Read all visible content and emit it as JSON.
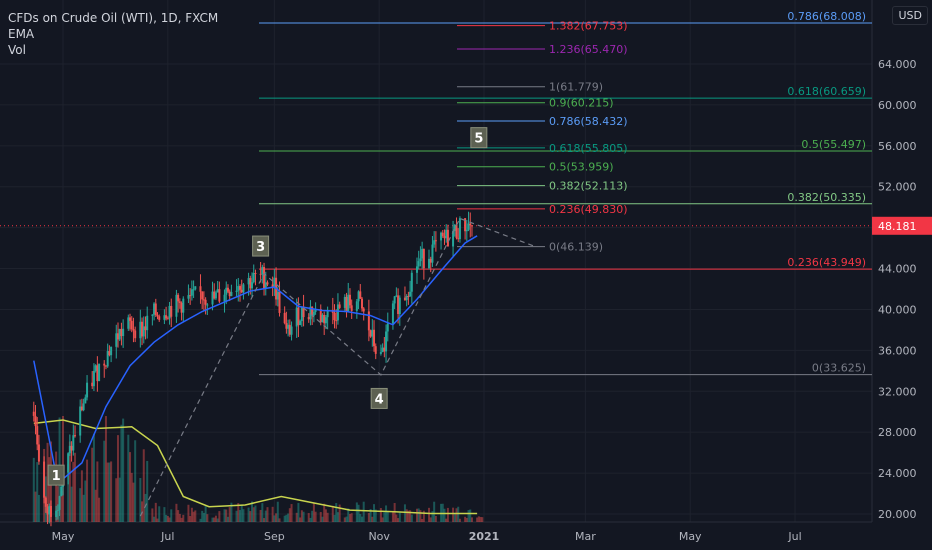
{
  "legend": {
    "title": "CFDs on Crude Oil (WTI), 1D, FXCM",
    "ema_label": "EMA",
    "vol_label": "Vol"
  },
  "currency_button": "USD",
  "chart_data": {
    "type": "line",
    "title": "CFDs on Crude Oil (WTI), 1D, FXCM",
    "x_ticks": [
      "May",
      "Jul",
      "Sep",
      "Nov",
      "2021",
      "Mar",
      "May",
      "Jul"
    ],
    "y_ticks": [
      "20.000",
      "24.000",
      "28.000",
      "32.000",
      "36.000",
      "40.000",
      "44.000",
      "48.000",
      "52.000",
      "56.000",
      "60.000",
      "64.000"
    ],
    "ylim": [
      19.5,
      70
    ],
    "price_label": "48.181",
    "colors": {
      "background": "#131722",
      "ema": "#2962ff",
      "volume_ma": "#c8d44e",
      "up": "#26a69a",
      "down": "#ef5350",
      "price_tag": "#f23645"
    },
    "wave_labels": [
      {
        "label": "1",
        "x": "2020-04-27",
        "y": 23.8
      },
      {
        "label": "3",
        "x": "2020-08-24",
        "y": 46.2
      },
      {
        "label": "4",
        "x": "2020-11-01",
        "y": 31.3
      },
      {
        "label": "5",
        "x": "2020-12-29",
        "y": 56.8
      }
    ],
    "elliott_path": [
      {
        "x": "2020-06-15",
        "y": 19.8
      },
      {
        "x": "2020-08-26",
        "y": 43.5
      },
      {
        "x": "2020-11-02",
        "y": 33.6
      },
      {
        "x": "2020-12-18",
        "y": 48.9
      },
      {
        "x": "2021-01-30",
        "y": 46.2
      }
    ],
    "fib_left": [
      {
        "label": "0.786(68.008)",
        "value": 68.008,
        "color": "#5b9cf6"
      },
      {
        "label": "0.618(60.659)",
        "value": 60.659,
        "color": "#089981"
      },
      {
        "label": "0.5(55.497)",
        "value": 55.497,
        "color": "#4caf50"
      },
      {
        "label": "0.382(50.335)",
        "value": 50.335,
        "color": "#81c784"
      },
      {
        "label": "0.236(43.949)",
        "value": 43.949,
        "color": "#f23645"
      },
      {
        "label": "0(33.625)",
        "value": 33.625,
        "color": "#787b86"
      }
    ],
    "fib_right": [
      {
        "label": "1.382(67.753)",
        "value": 67.753,
        "color": "#f23645"
      },
      {
        "label": "1.236(65.470)",
        "value": 65.47,
        "color": "#9c27b0"
      },
      {
        "label": "1(61.779)",
        "value": 61.779,
        "color": "#787b86"
      },
      {
        "label": "0.9(60.215)",
        "value": 60.215,
        "color": "#4caf50"
      },
      {
        "label": "0.786(58.432)",
        "value": 58.432,
        "color": "#5b9cf6"
      },
      {
        "label": "0.618(55.805)",
        "value": 55.805,
        "color": "#089981"
      },
      {
        "label": "0.5(53.959)",
        "value": 53.959,
        "color": "#4caf50"
      },
      {
        "label": "0.382(52.113)",
        "value": 52.113,
        "color": "#81c784"
      },
      {
        "label": "0.236(49.830)",
        "value": 49.83,
        "color": "#f23645"
      },
      {
        "label": "0(46.139)",
        "value": 46.139,
        "color": "#787b86"
      }
    ],
    "close_series": [
      {
        "x": "2020-04-14",
        "y": 30.0
      },
      {
        "x": "2020-04-21",
        "y": 19.9
      },
      {
        "x": "2020-04-28",
        "y": 21.5
      },
      {
        "x": "2020-05-05",
        "y": 26.0
      },
      {
        "x": "2020-05-12",
        "y": 30.5
      },
      {
        "x": "2020-05-19",
        "y": 33.5
      },
      {
        "x": "2020-05-26",
        "y": 35.5
      },
      {
        "x": "2020-06-02",
        "y": 37.5
      },
      {
        "x": "2020-06-09",
        "y": 38.5
      },
      {
        "x": "2020-06-16",
        "y": 38.0
      },
      {
        "x": "2020-06-23",
        "y": 39.5
      },
      {
        "x": "2020-06-30",
        "y": 40.0
      },
      {
        "x": "2020-07-07",
        "y": 40.5
      },
      {
        "x": "2020-07-14",
        "y": 41.0
      },
      {
        "x": "2020-07-21",
        "y": 41.5
      },
      {
        "x": "2020-07-28",
        "y": 41.0
      },
      {
        "x": "2020-08-04",
        "y": 42.0
      },
      {
        "x": "2020-08-11",
        "y": 42.5
      },
      {
        "x": "2020-08-18",
        "y": 42.8
      },
      {
        "x": "2020-08-25",
        "y": 43.2
      },
      {
        "x": "2020-09-01",
        "y": 42.5
      },
      {
        "x": "2020-09-08",
        "y": 37.5
      },
      {
        "x": "2020-09-15",
        "y": 39.5
      },
      {
        "x": "2020-09-22",
        "y": 40.0
      },
      {
        "x": "2020-09-29",
        "y": 39.2
      },
      {
        "x": "2020-10-06",
        "y": 39.8
      },
      {
        "x": "2020-10-13",
        "y": 40.5
      },
      {
        "x": "2020-10-20",
        "y": 40.8
      },
      {
        "x": "2020-10-27",
        "y": 37.5
      },
      {
        "x": "2020-11-02",
        "y": 35.0
      },
      {
        "x": "2020-11-09",
        "y": 40.0
      },
      {
        "x": "2020-11-16",
        "y": 41.5
      },
      {
        "x": "2020-11-23",
        "y": 44.5
      },
      {
        "x": "2020-11-30",
        "y": 45.5
      },
      {
        "x": "2020-12-07",
        "y": 46.5
      },
      {
        "x": "2020-12-14",
        "y": 47.5
      },
      {
        "x": "2020-12-21",
        "y": 48.3
      },
      {
        "x": "2020-12-28",
        "y": 48.2
      }
    ],
    "ema_series": [
      {
        "x": "2020-04-14",
        "y": 35.0
      },
      {
        "x": "2020-04-28",
        "y": 23.0
      },
      {
        "x": "2020-05-12",
        "y": 25.0
      },
      {
        "x": "2020-05-26",
        "y": 30.5
      },
      {
        "x": "2020-06-09",
        "y": 34.5
      },
      {
        "x": "2020-06-23",
        "y": 36.8
      },
      {
        "x": "2020-07-07",
        "y": 38.5
      },
      {
        "x": "2020-07-21",
        "y": 39.8
      },
      {
        "x": "2020-08-04",
        "y": 40.8
      },
      {
        "x": "2020-08-18",
        "y": 41.8
      },
      {
        "x": "2020-09-01",
        "y": 42.2
      },
      {
        "x": "2020-09-15",
        "y": 40.3
      },
      {
        "x": "2020-09-29",
        "y": 39.9
      },
      {
        "x": "2020-10-13",
        "y": 39.8
      },
      {
        "x": "2020-10-27",
        "y": 39.4
      },
      {
        "x": "2020-11-09",
        "y": 38.5
      },
      {
        "x": "2020-11-23",
        "y": 41.0
      },
      {
        "x": "2020-12-07",
        "y": 43.8
      },
      {
        "x": "2020-12-21",
        "y": 46.5
      },
      {
        "x": "2020-12-28",
        "y": 47.2
      }
    ],
    "volume_ma_series": [
      {
        "x": "2020-04-14",
        "y": 0.58
      },
      {
        "x": "2020-05-01",
        "y": 0.6
      },
      {
        "x": "2020-05-20",
        "y": 0.55
      },
      {
        "x": "2020-06-10",
        "y": 0.56
      },
      {
        "x": "2020-06-25",
        "y": 0.45
      },
      {
        "x": "2020-07-10",
        "y": 0.15
      },
      {
        "x": "2020-07-25",
        "y": 0.09
      },
      {
        "x": "2020-08-15",
        "y": 0.1
      },
      {
        "x": "2020-09-05",
        "y": 0.15
      },
      {
        "x": "2020-09-20",
        "y": 0.12
      },
      {
        "x": "2020-10-15",
        "y": 0.07
      },
      {
        "x": "2020-11-10",
        "y": 0.06
      },
      {
        "x": "2020-12-01",
        "y": 0.05
      },
      {
        "x": "2020-12-28",
        "y": 0.05
      }
    ]
  }
}
